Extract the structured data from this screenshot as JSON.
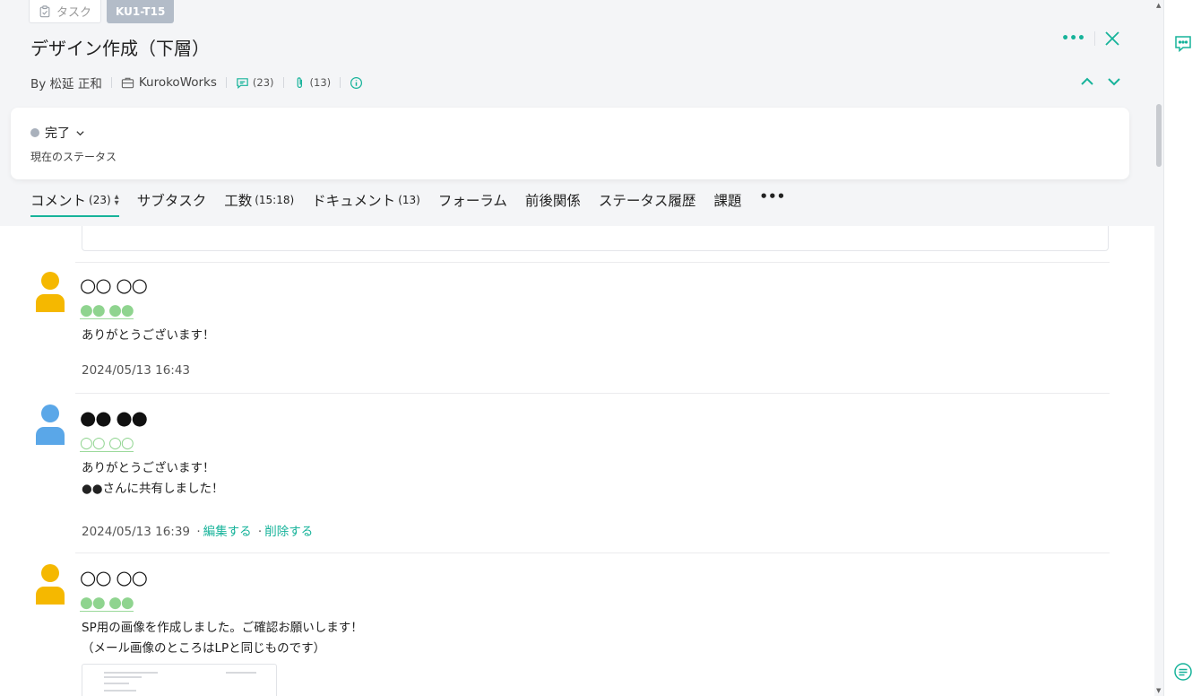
{
  "header": {
    "type_label": "タスク",
    "task_id": "KU1-T15",
    "title": "デザイン作成（下層）",
    "author": "By 松延 正和",
    "project": "KurokoWorks",
    "comments_count": "(23)",
    "attachments_count": "(13)"
  },
  "status": {
    "value": "完了",
    "caption": "現在のステータス"
  },
  "tabs": {
    "comment": "コメント",
    "comment_count": "(23)",
    "subtask": "サブタスク",
    "effort": "工数",
    "effort_count": "(15:18)",
    "document": "ドキュメント",
    "document_count": "(13)",
    "forum": "フォーラム",
    "relation": "前後関係",
    "status_history": "ステータス履歴",
    "issue": "課題"
  },
  "comments": [
    {
      "author": "○○ ○○",
      "role": "●● ●●",
      "lines": [
        "ありがとうございます！"
      ],
      "timestamp": "2024/05/13 16:43",
      "avatar_color": "#f5b800"
    },
    {
      "author": "●● ●●",
      "role": "○○ ○○",
      "lines": [
        "ありがとうございます！",
        "●●さんに共有しました！"
      ],
      "timestamp": "2024/05/13 16:39",
      "edit": "編集する",
      "delete": "削除する",
      "avatar_color": "#5aa7e8"
    },
    {
      "author": "○○ ○○",
      "role": "●● ●●",
      "lines": [
        "SP用の画像を作成しました。ご確認お願いします！",
        "（メール画像のところはLPと同じものです）"
      ],
      "avatar_color": "#f5b800"
    }
  ],
  "colors": {
    "accent": "#17b39a",
    "status_dot": "#a9b1bc",
    "role_green": "#8fd48f"
  },
  "icons": [
    "clipboard-icon",
    "more-icon",
    "close-icon",
    "briefcase-icon",
    "comment-icon",
    "paperclip-icon",
    "info-icon",
    "chevron-up-icon",
    "chevron-down-icon",
    "sort-icon",
    "chat-icon",
    "message-list-icon"
  ]
}
